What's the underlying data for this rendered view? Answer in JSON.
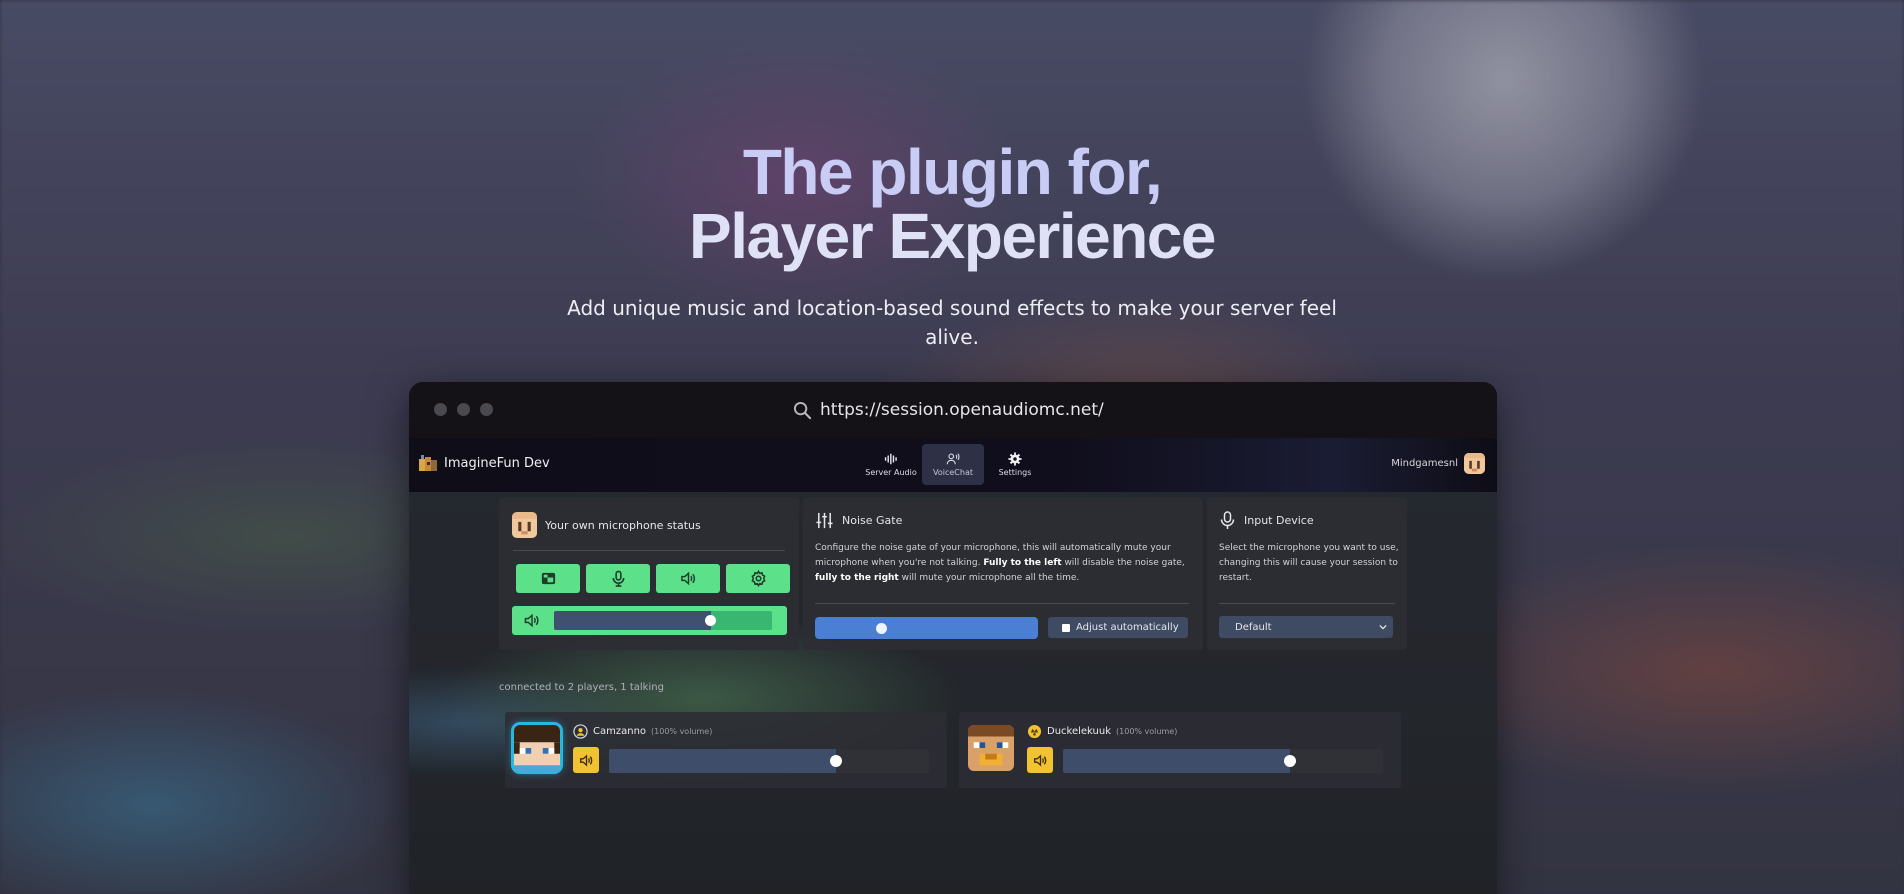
{
  "hero": {
    "title_line1": "The plugin for,",
    "title_line2": "Player Experience",
    "subtitle": "Add unique music and location-based sound effects to make your server feel alive."
  },
  "browser": {
    "url": "https://session.openaudiomc.net/"
  },
  "app": {
    "brand": "ImagineFun Dev",
    "tabs": [
      {
        "label": "Server Audio",
        "icon": "sound-wave-icon",
        "active": false
      },
      {
        "label": "VoiceChat",
        "icon": "voice-chat-icon",
        "active": true
      },
      {
        "label": "Settings",
        "icon": "gear-icon",
        "active": false
      }
    ],
    "user": "Mindgamesnl"
  },
  "mic_status": {
    "title": "Your own microphone status",
    "buttons": [
      "camera-icon",
      "microphone-icon",
      "speaker-icon",
      "gear-icon"
    ],
    "volume_level": 0.72
  },
  "noise_gate": {
    "title": "Noise Gate",
    "text_1": "Configure the noise gate of your microphone, this will automatically mute your microphone when you're not talking. ",
    "text_bold_1": "Fully to the left",
    "text_2": " will disable the noise gate, ",
    "text_bold_2": "fully to the right",
    "text_3": " will mute your microphone all the time.",
    "slider_level": 0.3,
    "auto_label": "Adjust automatically"
  },
  "input_device": {
    "title": "Input Device",
    "description": "Select the microphone you want to use, changing this will cause your session to restart.",
    "selected": "Default"
  },
  "connected_text": "connected to 2 players, 1 talking",
  "players": [
    {
      "name": "Camzanno",
      "volume_label": "(100% volume)",
      "talking": true,
      "volume_level": 0.71
    },
    {
      "name": "Duckelekuuk",
      "volume_label": "(100% volume)",
      "talking": false,
      "volume_level": 0.71
    }
  ],
  "colors": {
    "accent_green": "#5ce089",
    "accent_blue": "#4a7fd3",
    "mute_yellow": "#f1c232",
    "talking_ring": "#27b8e0"
  }
}
